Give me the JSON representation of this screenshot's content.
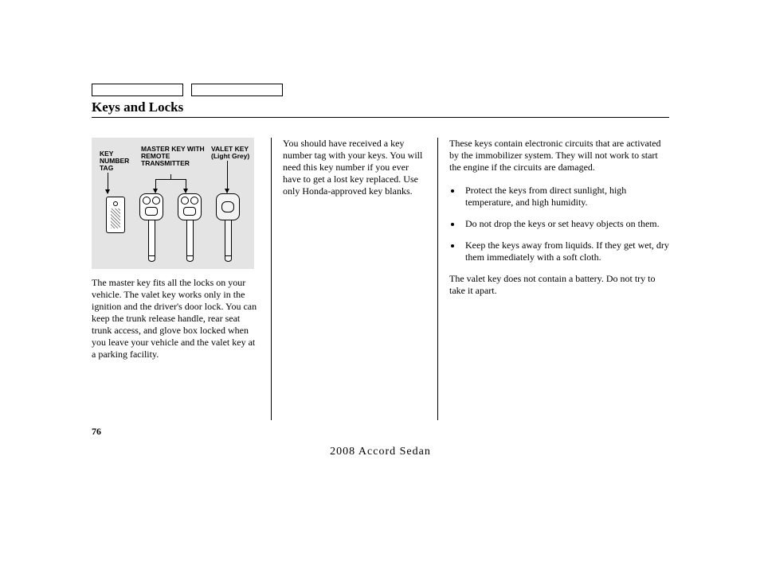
{
  "section_title": "Keys and Locks",
  "figure": {
    "label_tag": "KEY NUMBER TAG",
    "label_master": "MASTER KEY WITH REMOTE TRANSMITTER",
    "label_valet": "VALET KEY",
    "label_valet_sub": "(Light Grey)"
  },
  "col1": {
    "p1": "The master key fits all the locks on your vehicle. The valet key works only in the ignition and the driver's door lock. You can keep the trunk release handle, rear seat trunk access, and glove box locked when you leave your vehicle and the valet key at a parking facility."
  },
  "col2": {
    "p1": "You should have received a key number tag with your keys. You will need this key number if you ever have to get a lost key replaced. Use only Honda-approved key blanks."
  },
  "col3": {
    "p1": "These keys contain electronic circuits that are activated by the immobilizer system. They will not work to start the engine if the circuits are damaged.",
    "b1": "Protect the keys from direct sunlight, high temperature, and high humidity.",
    "b2": "Do not drop the keys or set heavy objects on them.",
    "b3": "Keep the keys away from liquids. If they get wet, dry them immediately with a soft cloth.",
    "p2": "The valet key does not contain a battery. Do not try to take it apart."
  },
  "page_number": "76",
  "footer": "2008  Accord  Sedan"
}
